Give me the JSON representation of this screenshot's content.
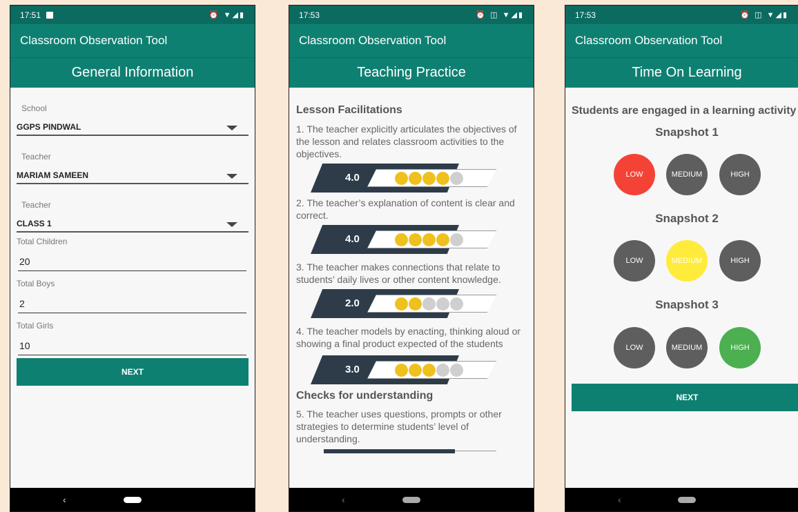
{
  "app_title": "Classroom Observation Tool",
  "screens": {
    "general": {
      "time": "17:51",
      "status_icons": "⏰ ▼◢▮",
      "section": "General Information",
      "spinners": [
        {
          "label": "School",
          "value": "GGPS PINDWAL"
        },
        {
          "label": "Teacher",
          "value": "MARIAM SAMEEN"
        },
        {
          "label": "Teacher",
          "value": "CLASS 1"
        }
      ],
      "fields": [
        {
          "label": "Total Children",
          "value": "20"
        },
        {
          "label": "Total Boys",
          "value": "2"
        },
        {
          "label": "Total Girls",
          "value": "10"
        }
      ],
      "next": "NEXT"
    },
    "teaching": {
      "time": "17:53",
      "status_icons": "⏰ ◫ ▼◢▮",
      "section": "Teaching Practice",
      "heading1": "Lesson Facilitations",
      "heading2": "Checks for understanding",
      "questions": [
        {
          "text": "1. The teacher explicitly articulates the objectives of the lesson and relates classroom activities to the objectives.",
          "score": "4.0",
          "stars": 4
        },
        {
          "text": "2. The teacher’s explanation of content is clear and correct.",
          "score": "4.0",
          "stars": 4
        },
        {
          "text": "3. The teacher makes connections that relate to students’ daily lives or other content knowledge.",
          "score": "2.0",
          "stars": 2
        },
        {
          "text": "4. The teacher models by enacting, thinking aloud or showing a final product expected of the students",
          "score": "3.0",
          "stars": 3
        },
        {
          "text": "5. The teacher uses questions, prompts or other strategies to determine students’ level of understanding."
        }
      ]
    },
    "time_on_learning": {
      "time": "17:53",
      "status_icons": "⏰ ◫ ▼◢▮",
      "section": "Time On Learning",
      "heading": "Students are engaged in a learning activity",
      "snapshots": [
        {
          "title": "Snapshot 1",
          "low": "LOW",
          "medium": "MEDIUM",
          "high": "HIGH",
          "selected": "low"
        },
        {
          "title": "Snapshot 2",
          "low": "LOW",
          "medium": "MEDIUM",
          "high": "HIGH",
          "selected": "medium"
        },
        {
          "title": "Snapshot 3",
          "low": "LOW",
          "medium": "MEDIUM",
          "high": "HIGH",
          "selected": "high"
        }
      ],
      "next": "NEXT"
    }
  },
  "nav": {
    "back_glyph": "‹"
  },
  "colors": {
    "primary": "#0e8071",
    "status_bar": "#0b6b60",
    "star_on": "#efc11f",
    "star_off": "#cfcfcf",
    "rating_dark": "#2e3b49",
    "unselected": "#5e5e5e",
    "low_selected": "#f44336",
    "medium_selected": "#ffeb3b",
    "high_selected": "#4caf50"
  }
}
